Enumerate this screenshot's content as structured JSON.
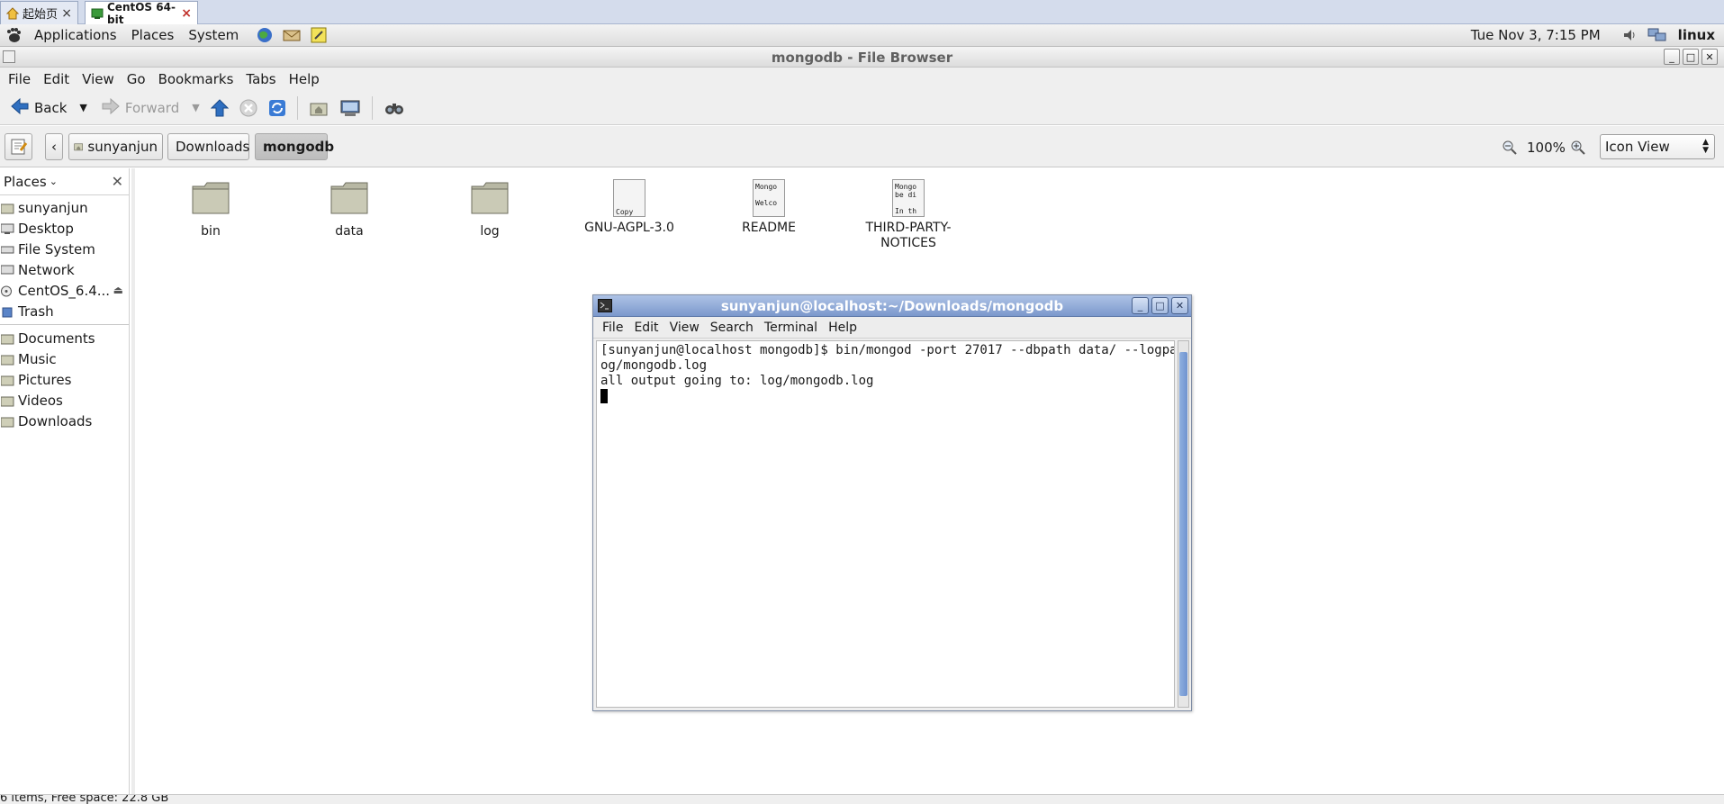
{
  "vm_tabs": [
    {
      "label": "起始页",
      "close": "×"
    },
    {
      "label": "CentOS 64-bit",
      "close": "×"
    }
  ],
  "panel": {
    "menus": [
      "Applications",
      "Places",
      "System"
    ],
    "datetime": "Tue Nov  3,  7:15 PM",
    "user": "linux"
  },
  "window": {
    "title": "mongodb - File Browser",
    "menus": [
      "File",
      "Edit",
      "View",
      "Go",
      "Bookmarks",
      "Tabs",
      "Help"
    ]
  },
  "toolbar": {
    "back": "Back",
    "forward": "Forward"
  },
  "location": {
    "crumbs": [
      "sunyanjun",
      "Downloads",
      "mongodb"
    ],
    "zoom": "100%",
    "view_mode": "Icon View"
  },
  "sidebar": {
    "header": "Places",
    "places": [
      "sunyanjun",
      "Desktop",
      "File System",
      "Network",
      "CentOS_6.4...",
      "Trash"
    ],
    "bookmarks": [
      "Documents",
      "Music",
      "Pictures",
      "Videos",
      "Downloads"
    ]
  },
  "files": [
    {
      "name": "bin",
      "kind": "folder"
    },
    {
      "name": "data",
      "kind": "folder"
    },
    {
      "name": "log",
      "kind": "folder"
    },
    {
      "name": "GNU-AGPL-3.0",
      "kind": "text",
      "preview": [
        "",
        "",
        "Copy"
      ]
    },
    {
      "name": "README",
      "kind": "text",
      "preview": [
        "Mongo",
        "",
        "Welco"
      ]
    },
    {
      "name": "THIRD-PARTY-\nNOTICES",
      "kind": "text",
      "preview": [
        "Mongo",
        "be di",
        "",
        "In th"
      ]
    }
  ],
  "status": "6 items, Free space: 22.8 GB",
  "terminal": {
    "title": "sunyanjun@localhost:~/Downloads/mongodb",
    "menus": [
      "File",
      "Edit",
      "View",
      "Search",
      "Terminal",
      "Help"
    ],
    "lines": [
      "[sunyanjun@localhost mongodb]$ bin/mongod -port 27017 --dbpath data/ --logpath l",
      "og/mongodb.log",
      "all output going to: log/mongodb.log"
    ]
  }
}
